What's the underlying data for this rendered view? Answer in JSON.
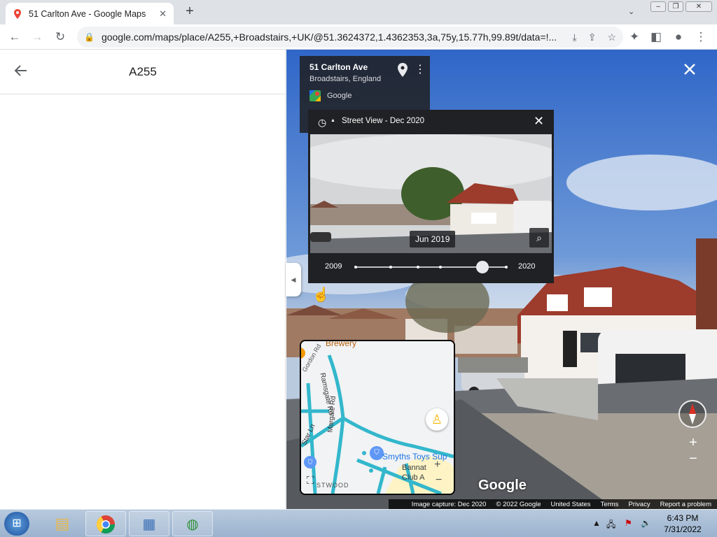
{
  "browser": {
    "tab_title": "51 Carlton Ave - Google Maps",
    "url": "google.com/maps/place/A255,+Broadstairs,+UK/@51.3624372,1.4362353,3a,75y,15.77h,99.89t/data=!..."
  },
  "side_panel": {
    "title": "A255"
  },
  "address_card": {
    "line1": "51 Carlton Ave",
    "line2": "Broadstairs, England",
    "source": "Google"
  },
  "time_travel": {
    "header": "Street View - Dec 2020",
    "selected_date": "Jun 2019",
    "year_start": "2009",
    "year_end": "2020"
  },
  "minimap": {
    "labels": [
      "Ramsgate Rd",
      "Gordon Rd",
      "Star Ln",
      "Margate Rd",
      "Smyths Toys Sup",
      "Bannat",
      "Club A",
      "STWOOD",
      "Brewery"
    ]
  },
  "street_view": {
    "logo": "Google",
    "footer": {
      "capture": "Image capture: Dec 2020",
      "copyright": "© 2022 Google",
      "country": "United States",
      "terms": "Terms",
      "privacy": "Privacy",
      "report": "Report a problem"
    }
  },
  "taskbar": {
    "time": "6:43 PM",
    "date": "7/31/2022"
  }
}
